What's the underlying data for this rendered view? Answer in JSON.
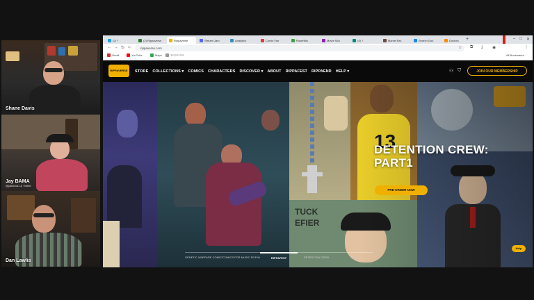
{
  "participants": [
    {
      "name": "Shane Davis",
      "subtitle": ""
    },
    {
      "name": "Jay BAMA",
      "subtitle": "@jaibama1 & Twitter"
    },
    {
      "name": "Dan Lawlis",
      "subtitle": ""
    }
  ],
  "browser": {
    "tabs": [
      {
        "label": "(2) ?",
        "color": "#1da1f2"
      },
      {
        "label": "(2) Rippaverse",
        "color": "#2e7d32"
      },
      {
        "label": "Rippaverse",
        "color": "#f0b000",
        "active": true
      },
      {
        "label": "Stream Jam",
        "color": "#5865f2"
      },
      {
        "label": "Analytics",
        "color": "#3c8dbc"
      },
      {
        "label": "Comic Fan",
        "color": "#e53935"
      },
      {
        "label": "RoseHills",
        "color": "#43a047"
      },
      {
        "label": "Movie Slot",
        "color": "#8e24aa"
      },
      {
        "label": "(4) ?",
        "color": "#00897b"
      },
      {
        "label": "Marvel Bro",
        "color": "#6d4c41"
      },
      {
        "label": "Search Goo",
        "color": "#1e88e5"
      },
      {
        "label": "Doctors",
        "color": "#fb8c00"
      }
    ],
    "new_tab": "+",
    "window_controls": [
      "–",
      "□",
      "✕"
    ],
    "url": "rippaverse.com",
    "bookmarks": [
      {
        "label": "Gmail",
        "color": "#d93025"
      },
      {
        "label": "YouTube",
        "color": "#ff0000"
      },
      {
        "label": "Maps",
        "color": "#34a853"
      },
      {
        "label": "?????????",
        "color": "#999999"
      }
    ],
    "all_bookmarks": "All Bookmarks"
  },
  "site": {
    "logo_text": "RIPPAVERSE",
    "nav": [
      "STORE",
      "COLLECTIONS ▾",
      "COMICS",
      "CHARACTERS",
      "DISCOVER ▾",
      "ABOUT",
      "RIPPAFEST",
      "RIPPAEND",
      "HELP ▾"
    ],
    "member_button": "JOIN OUR MEMBERSHIP",
    "hero": {
      "title_line1": "DETENTION CREW:",
      "title_line2": "PART1",
      "cta": "PRE-ORDER NOW",
      "slider_tabs": [
        "GENETIC WARFARE COMICS",
        "COMICS FOR MUSIC ENTHUSIASTS",
        "RIPPAFEST",
        "DETENTION CREW",
        "SITE"
      ],
      "active_slider": 2,
      "help": "Help"
    }
  }
}
